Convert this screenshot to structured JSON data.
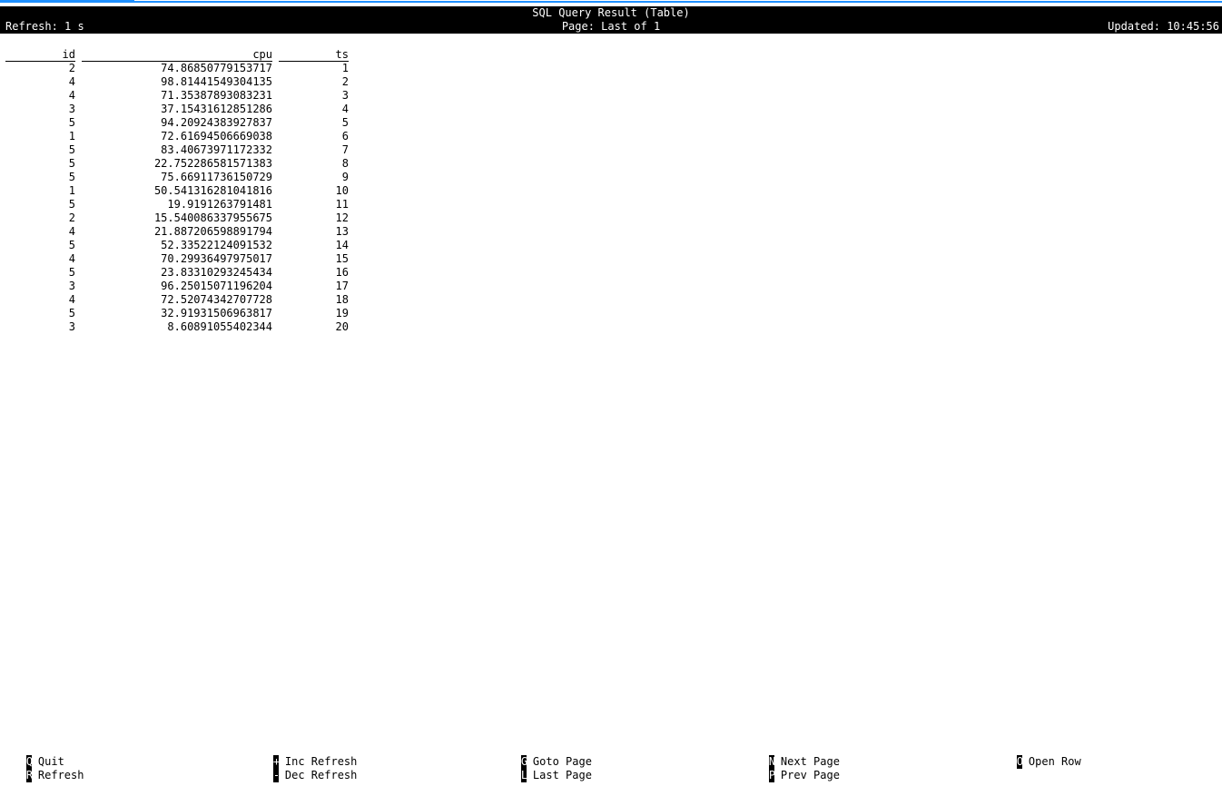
{
  "header": {
    "title": "SQL Query Result (Table)",
    "page": "Page: Last of 1",
    "refresh": "Refresh: 1 s",
    "updated": "Updated: 10:45:56"
  },
  "table": {
    "columns": [
      "id",
      "cpu",
      "ts"
    ],
    "rows": [
      [
        "2",
        "74.86850779153717",
        "1"
      ],
      [
        "4",
        "98.81441549304135",
        "2"
      ],
      [
        "4",
        "71.35387893083231",
        "3"
      ],
      [
        "3",
        "37.15431612851286",
        "4"
      ],
      [
        "5",
        "94.20924383927837",
        "5"
      ],
      [
        "1",
        "72.61694506669038",
        "6"
      ],
      [
        "5",
        "83.40673971172332",
        "7"
      ],
      [
        "5",
        "22.752286581571383",
        "8"
      ],
      [
        "5",
        "75.66911736150729",
        "9"
      ],
      [
        "1",
        "50.541316281041816",
        "10"
      ],
      [
        "5",
        "19.9191263791481",
        "11"
      ],
      [
        "2",
        "15.540086337955675",
        "12"
      ],
      [
        "4",
        "21.887206598891794",
        "13"
      ],
      [
        "5",
        "52.33522124091532",
        "14"
      ],
      [
        "4",
        "70.29936497975017",
        "15"
      ],
      [
        "5",
        "23.83310293245434",
        "16"
      ],
      [
        "3",
        "96.25015071196204",
        "17"
      ],
      [
        "4",
        "72.52074342707728",
        "18"
      ],
      [
        "5",
        "32.91931506963817",
        "19"
      ],
      [
        "3",
        "8.60891055402344",
        "20"
      ]
    ]
  },
  "footer": {
    "quit": {
      "key": "Q",
      "label": "Quit"
    },
    "refresh": {
      "key": "R",
      "label": "Refresh"
    },
    "inc_refresh": {
      "key": "+",
      "label": "Inc Refresh"
    },
    "dec_refresh": {
      "key": "-",
      "label": "Dec Refresh"
    },
    "goto_page": {
      "key": "G",
      "label": "Goto Page"
    },
    "last_page": {
      "key": "L",
      "label": "Last Page"
    },
    "next_page": {
      "key": "N",
      "label": "Next Page"
    },
    "prev_page": {
      "key": "P",
      "label": "Prev Page"
    },
    "open_row": {
      "key": "O",
      "label": "Open Row"
    }
  },
  "colors": {
    "accent": "#1e90ff",
    "header_bg": "#000000",
    "header_fg": "#ffffff"
  }
}
